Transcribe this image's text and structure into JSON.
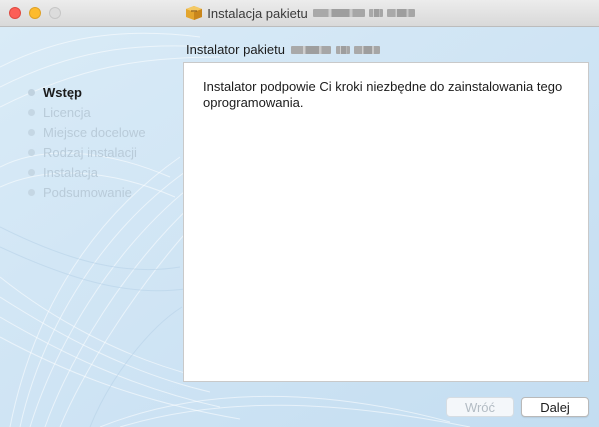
{
  "window": {
    "title": "Instalacja pakietu",
    "package_name_redacted": true
  },
  "header": {
    "label": "Instalator pakietu"
  },
  "sidebar": {
    "steps": [
      {
        "label": "Wstęp",
        "active": true
      },
      {
        "label": "Licencja",
        "active": false
      },
      {
        "label": "Miejsce docelowe",
        "active": false
      },
      {
        "label": "Rodzaj instalacji",
        "active": false
      },
      {
        "label": "Instalacja",
        "active": false
      },
      {
        "label": "Podsumowanie",
        "active": false
      }
    ]
  },
  "content": {
    "text": "Instalator podpowie Ci kroki niezbędne do zainstalowania tego oprogramowania."
  },
  "buttons": {
    "back": "Wróć",
    "next": "Dalej"
  },
  "colors": {
    "background": "#d7e9f6",
    "close": "#fc5f57",
    "minimize": "#fdbb2e",
    "maximize_inactive": "#dcdcdc"
  },
  "icons": {
    "title": "package-icon"
  }
}
